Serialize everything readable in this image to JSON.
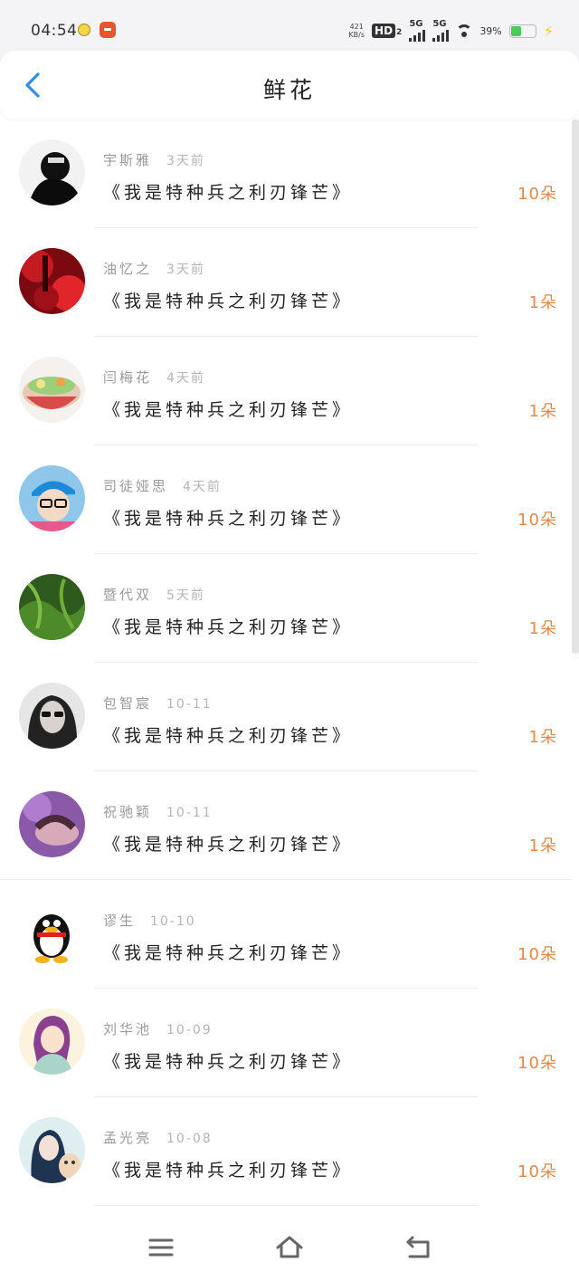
{
  "status_bar": {
    "time": "04:54",
    "speed_value": "421",
    "speed_unit": "KB/s",
    "hd_label": "HD",
    "hd_sub": "2",
    "net1": "5G",
    "net2": "5G",
    "battery_percent": "39%",
    "icons": [
      "notification-icon",
      "app-icon",
      "wifi-icon",
      "battery-icon",
      "charging-icon"
    ]
  },
  "header": {
    "title": "鲜花",
    "back_icon": "chevron-left-icon"
  },
  "items": [
    {
      "name": "宇斯雅",
      "time": "3天前",
      "book": "《我是特种兵之利刃锋芒》",
      "count": "10朵"
    },
    {
      "name": "油忆之",
      "time": "3天前",
      "book": "《我是特种兵之利刃锋芒》",
      "count": "1朵"
    },
    {
      "name": "闫梅花",
      "time": "4天前",
      "book": "《我是特种兵之利刃锋芒》",
      "count": "1朵"
    },
    {
      "name": "司徒娅思",
      "time": "4天前",
      "book": "《我是特种兵之利刃锋芒》",
      "count": "10朵"
    },
    {
      "name": "暨代双",
      "time": "5天前",
      "book": "《我是特种兵之利刃锋芒》",
      "count": "1朵"
    },
    {
      "name": "包智宸",
      "time": "10-11",
      "book": "《我是特种兵之利刃锋芒》",
      "count": "1朵"
    },
    {
      "name": "祝驰颖",
      "time": "10-11",
      "book": "《我是特种兵之利刃锋芒》",
      "count": "1朵"
    },
    {
      "name": "谬生",
      "time": "10-10",
      "book": "《我是特种兵之利刃锋芒》",
      "count": "10朵"
    },
    {
      "name": "刘华池",
      "time": "10-09",
      "book": "《我是特种兵之利刃锋芒》",
      "count": "10朵"
    },
    {
      "name": "孟光亮",
      "time": "10-08",
      "book": "《我是特种兵之利刃锋芒》",
      "count": "10朵"
    }
  ],
  "colors": {
    "accent": "#2f8ee5",
    "count": "#e0894a",
    "meta": "#9a9a9a"
  },
  "navbar": {
    "icons": [
      "menu-icon",
      "home-icon",
      "back-icon"
    ]
  }
}
